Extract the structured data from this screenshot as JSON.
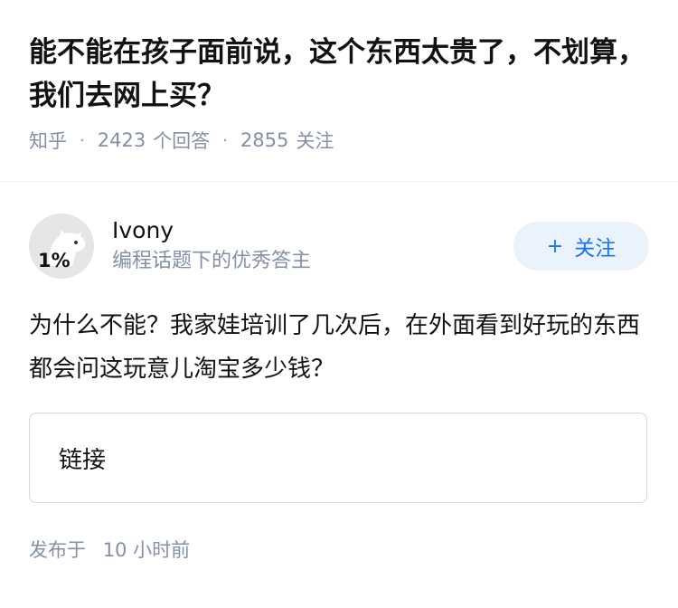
{
  "question": {
    "title": "能不能在孩子面前说，这个东西太贵了，不划算，我们去网上买？",
    "source": "知乎",
    "answer_count": "2423",
    "answer_label": "个回答",
    "follow_count": "2855",
    "follow_label": "关注"
  },
  "answer": {
    "author": {
      "name": "Ivony",
      "description": "编程话题下的优秀答主",
      "avatar_badge": "1%"
    },
    "follow_button": {
      "icon": "plus-icon",
      "label": "关注"
    },
    "body": "为什么不能？我家娃培训了几次后，在外面看到好玩的东西都会问这玩意儿淘宝多少钱？",
    "link_card_label": "链接",
    "posted_label": "发布于",
    "posted_time": "10 小时前"
  },
  "colors": {
    "text": "#121212",
    "muted": "#8590a6",
    "accent": "#1772f6",
    "button_bg": "#eaf2fb"
  }
}
